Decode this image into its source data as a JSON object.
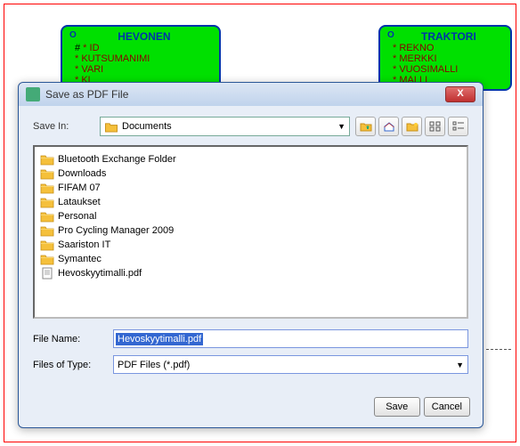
{
  "entities": {
    "left": {
      "title": "HEVONEN",
      "attrs": [
        "ID",
        "KUTSUMANIMI",
        "VARI",
        "KL"
      ]
    },
    "right": {
      "title": "TRAKTORI",
      "attrs": [
        "REKNO",
        "MERKKI",
        "VUOSIMALLI",
        "MALLI"
      ]
    }
  },
  "dialog": {
    "title": "Save as PDF File",
    "saveInLabel": "Save In:",
    "saveInValue": "Documents",
    "files": [
      {
        "name": "Bluetooth Exchange Folder",
        "type": "folder"
      },
      {
        "name": "Downloads",
        "type": "folder"
      },
      {
        "name": "FIFAM 07",
        "type": "folder"
      },
      {
        "name": "Lataukset",
        "type": "folder"
      },
      {
        "name": "Personal",
        "type": "folder"
      },
      {
        "name": "Pro Cycling Manager 2009",
        "type": "folder"
      },
      {
        "name": "Saariston IT",
        "type": "folder"
      },
      {
        "name": "Symantec",
        "type": "folder"
      },
      {
        "name": "Hevoskyytimalli.pdf",
        "type": "file"
      }
    ],
    "fileNameLabel": "File Name:",
    "fileNameValue": "Hevoskyytimalli.pdf",
    "fileTypeLabel": "Files of Type:",
    "fileTypeValue": "PDF Files (*.pdf)",
    "saveBtn": "Save",
    "cancelBtn": "Cancel",
    "closeX": "X"
  }
}
